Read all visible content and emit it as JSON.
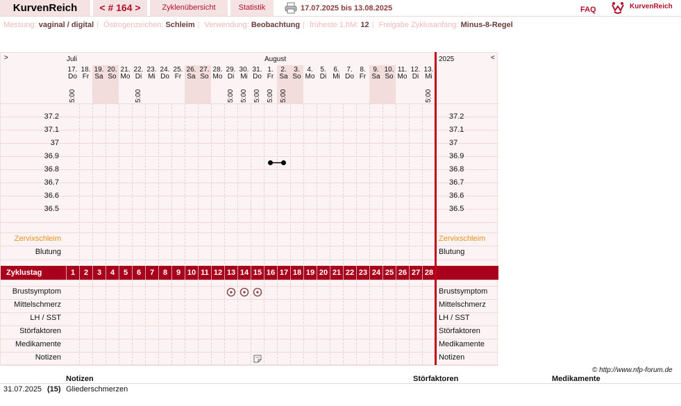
{
  "header": {
    "brand": "KurvenReich",
    "cycle_nav": "< # 164 >",
    "overview": "Zyklenübersicht",
    "stats": "Statistik",
    "range": "17.07.2025 bis 13.08.2025",
    "faq": "FAQ",
    "logo": "KurvenReich"
  },
  "meta": {
    "measure_label": "Messung:",
    "measure": "vaginal / digital",
    "estrogen_label": "Östrogenzeichen:",
    "estrogen": "Schleim",
    "usage_label": "Verwendung:",
    "usage": "Beobachtung",
    "earliest_label": "früheste 1.hM:",
    "earliest": "12",
    "release_label": "Freigabe Zyklusanfang:",
    "release": "Minus-8-Regel"
  },
  "chart": {
    "nav_left": ">",
    "nav_right": "<",
    "month_july": "Juli",
    "month_august": "August",
    "year": "2025",
    "days": [
      {
        "n": "17.",
        "d": "Do",
        "t": "5:00",
        "w": false
      },
      {
        "n": "18.",
        "d": "Fr",
        "t": "",
        "w": false
      },
      {
        "n": "19.",
        "d": "Sa",
        "t": "",
        "w": true
      },
      {
        "n": "20.",
        "d": "So",
        "t": "",
        "w": true
      },
      {
        "n": "21.",
        "d": "Mo",
        "t": "",
        "w": false
      },
      {
        "n": "22.",
        "d": "Di",
        "t": "5:00",
        "w": false
      },
      {
        "n": "23.",
        "d": "Mi",
        "t": "",
        "w": false
      },
      {
        "n": "24.",
        "d": "Do",
        "t": "",
        "w": false
      },
      {
        "n": "25.",
        "d": "Fr",
        "t": "",
        "w": false
      },
      {
        "n": "26.",
        "d": "Sa",
        "t": "",
        "w": true
      },
      {
        "n": "27.",
        "d": "So",
        "t": "",
        "w": true
      },
      {
        "n": "28.",
        "d": "Mo",
        "t": "",
        "w": false
      },
      {
        "n": "29.",
        "d": "Di",
        "t": "5:00",
        "w": false
      },
      {
        "n": "30.",
        "d": "Mi",
        "t": "5:00",
        "w": false
      },
      {
        "n": "31.",
        "d": "Do",
        "t": "5:00",
        "w": false
      },
      {
        "n": "1.",
        "d": "Fr",
        "t": "5:00",
        "w": false
      },
      {
        "n": "2.",
        "d": "Sa",
        "t": "5:00",
        "w": true
      },
      {
        "n": "3.",
        "d": "So",
        "t": "",
        "w": true
      },
      {
        "n": "4.",
        "d": "Mo",
        "t": "",
        "w": false
      },
      {
        "n": "5.",
        "d": "Di",
        "t": "",
        "w": false
      },
      {
        "n": "6.",
        "d": "Mi",
        "t": "",
        "w": false
      },
      {
        "n": "7.",
        "d": "Do",
        "t": "",
        "w": false
      },
      {
        "n": "8.",
        "d": "Fr",
        "t": "",
        "w": false
      },
      {
        "n": "9.",
        "d": "Sa",
        "t": "",
        "w": true
      },
      {
        "n": "10.",
        "d": "So",
        "t": "",
        "w": true
      },
      {
        "n": "11.",
        "d": "Mo",
        "t": "",
        "w": false
      },
      {
        "n": "12.",
        "d": "Di",
        "t": "",
        "w": false
      },
      {
        "n": "13.",
        "d": "Mi",
        "t": "5:00",
        "w": false
      }
    ],
    "temps": [
      "37.2",
      "37.1",
      "37",
      "36.9",
      "36.8",
      "36.7",
      "36.6",
      "36.5"
    ],
    "temp_points": [
      {
        "day": 16,
        "value": 36.85
      },
      {
        "day": 17,
        "value": 36.85
      }
    ],
    "rows": {
      "mucus": "Zervixschleim",
      "bleeding": "Blutung",
      "cycle_day": "Zyklustag",
      "breast": "Brustsymptom",
      "midpain": "Mittelschmerz",
      "lh": "LH / SST",
      "disturb": "Störfaktoren",
      "meds": "Medikamente",
      "notes": "Notizen"
    },
    "cycle_days": [
      "1",
      "2",
      "3",
      "4",
      "5",
      "6",
      "7",
      "8",
      "9",
      "10",
      "11",
      "12",
      "13",
      "14",
      "15",
      "16",
      "17",
      "18",
      "19",
      "20",
      "21",
      "22",
      "23",
      "24",
      "25",
      "26",
      "27",
      "28"
    ],
    "breast_symptom_days": [
      13,
      14,
      15
    ],
    "note_days": [
      15
    ]
  },
  "footer": {
    "url": "© http://www.nfp-forum.de",
    "col_notes": "Notizen",
    "col_disturb": "Störfaktoren",
    "col_meds": "Medikamente",
    "date": "31.07.2025",
    "day": "(15)",
    "note": "Gliederschmerzen"
  }
}
